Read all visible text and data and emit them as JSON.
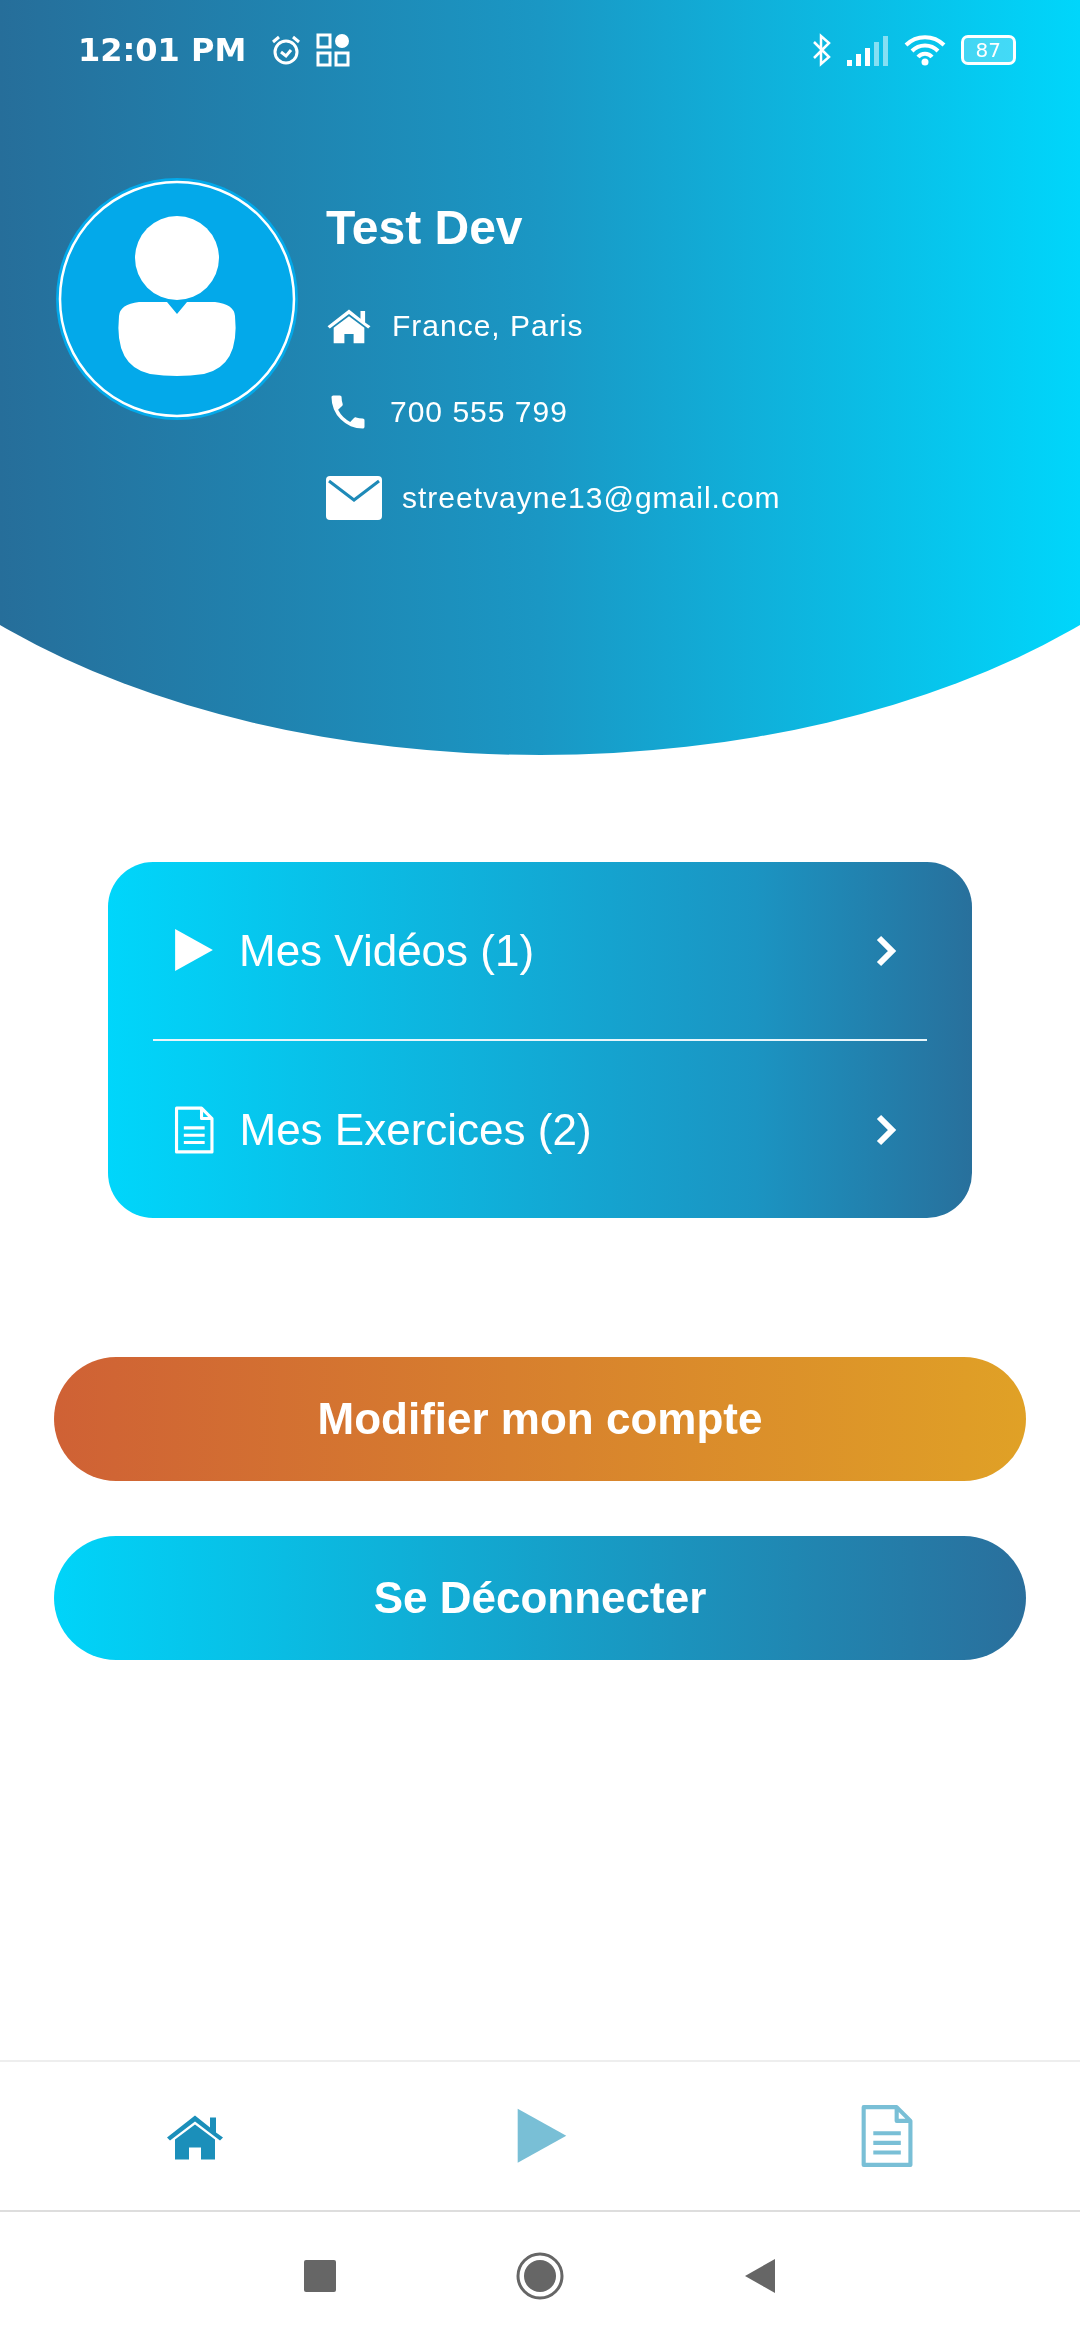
{
  "status_bar": {
    "time": "12:01 PM",
    "battery": "87"
  },
  "profile": {
    "name": "Test Dev",
    "details": [
      {
        "kind": "address",
        "text": "France, Paris"
      },
      {
        "kind": "phone",
        "text": "700 555 799"
      },
      {
        "kind": "email",
        "text": "streetvayne13@gmail.com"
      }
    ]
  },
  "menu": [
    {
      "kind": "video",
      "label": "Mes Vidéos (1)"
    },
    {
      "kind": "document",
      "label": "Mes Exercices (2)"
    }
  ],
  "buttons": [
    {
      "kind": "edit",
      "label": "Modifier mon compte"
    },
    {
      "kind": "logout",
      "label": "Se Déconnecter"
    }
  ],
  "bottom_nav": [
    {
      "kind": "home",
      "selected": true
    },
    {
      "kind": "video",
      "selected": false
    },
    {
      "kind": "document",
      "selected": false
    }
  ]
}
